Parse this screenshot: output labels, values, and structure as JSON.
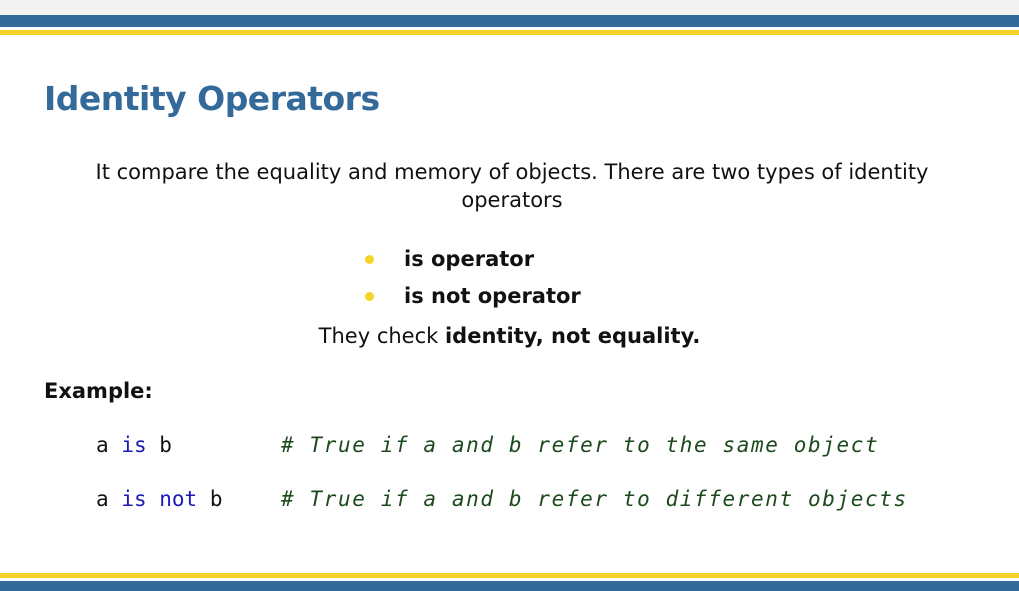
{
  "title": "Identity Operators",
  "intro": "It compare the equality and memory of objects. There are two types of identity operators",
  "bullets": [
    {
      "label": "is operator"
    },
    {
      "label": "is not operator"
    }
  ],
  "check_line": {
    "prefix": "They check ",
    "bold": "identity, not equality."
  },
  "example_label": "Example:",
  "code": [
    {
      "var_a": "a",
      "keyword": "is",
      "var_b": "b",
      "comment": "# True if a and b refer to the same object"
    },
    {
      "var_a": "a",
      "keyword": "is not",
      "var_b": "b",
      "comment": "# True if a and b refer to different objects"
    }
  ],
  "colors": {
    "title": "#336a99",
    "bar_blue": "#336a99",
    "bar_yellow": "#f5d327",
    "bullet_dot": "#f5d327",
    "keyword": "#1a1ab8",
    "comment": "#1d4a1d"
  }
}
